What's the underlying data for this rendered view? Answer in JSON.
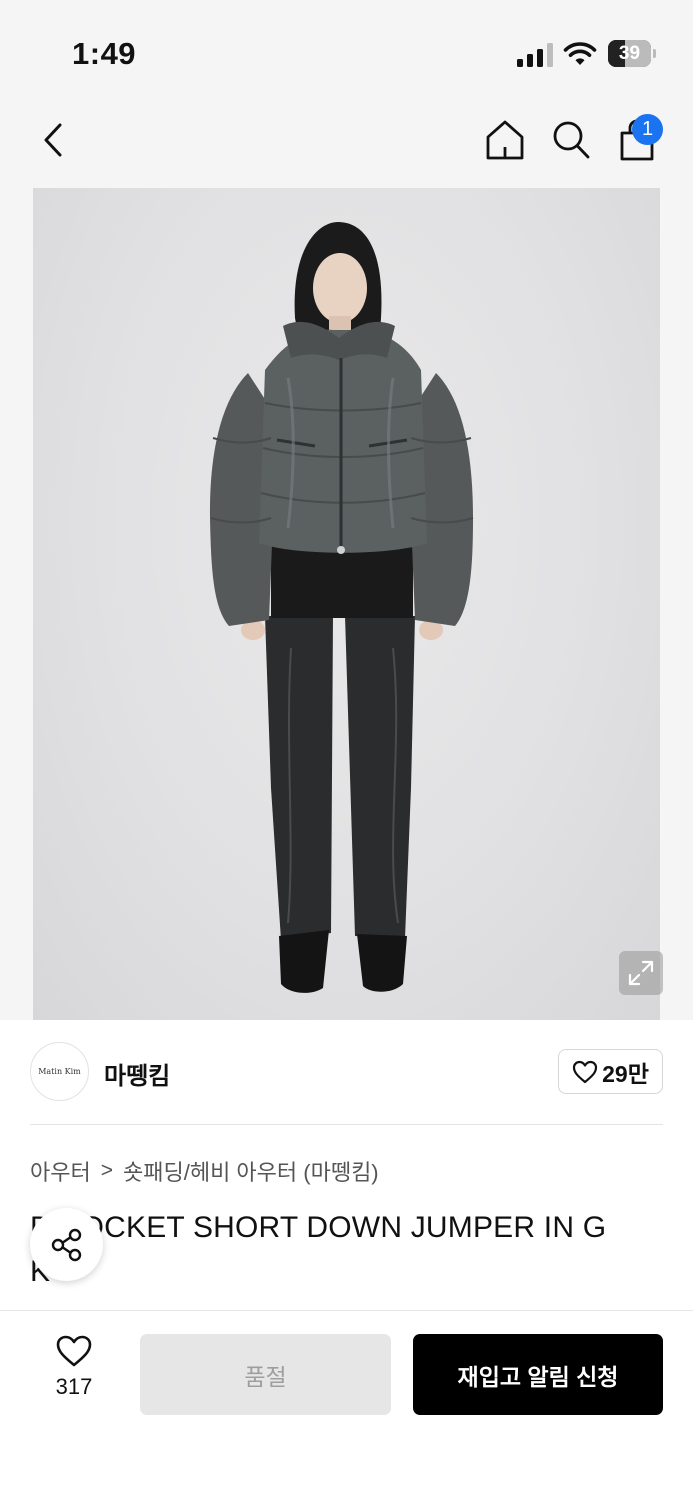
{
  "status_bar": {
    "time": "1:49",
    "battery_percent": "39"
  },
  "nav": {
    "back_icon": "chevron-left-icon",
    "home_icon": "home-icon",
    "search_icon": "search-icon",
    "cart_icon": "shopping-bag-icon",
    "cart_badge": "1"
  },
  "product_image": {
    "expand_icon": "expand-icon"
  },
  "brand": {
    "logo_text": "Matin Kim",
    "name": "마뗑킴",
    "likes": "29만",
    "like_icon": "heart-outline-icon"
  },
  "breadcrumb": {
    "level1": "아우터",
    "separator": ">",
    "level2": "숏패딩/헤비 아우터 (마뗑킴)"
  },
  "product": {
    "title_line1": "D  POCKET SHORT DOWN JUMPER IN G",
    "title_line2": "K"
  },
  "share_icon": "share-icon",
  "bottom_bar": {
    "wish_count": "317",
    "wish_icon": "heart-outline-icon",
    "soldout_label": "품절",
    "restock_label": "재입고 알림 신청"
  },
  "colors": {
    "accent_blue": "#1a73f0",
    "button_black": "#000000",
    "disabled_gray": "#e6e6e6"
  }
}
